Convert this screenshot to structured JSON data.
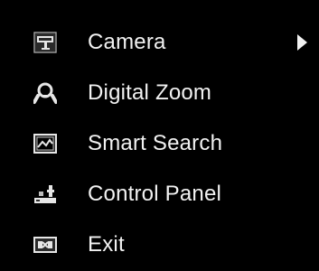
{
  "menu": {
    "items": [
      {
        "label": "Camera",
        "icon": "camera-icon",
        "has_submenu": true
      },
      {
        "label": "Digital Zoom",
        "icon": "digital-zoom-icon",
        "has_submenu": false
      },
      {
        "label": "Smart Search",
        "icon": "smart-search-icon",
        "has_submenu": false
      },
      {
        "label": "Control Panel",
        "icon": "control-panel-icon",
        "has_submenu": false
      },
      {
        "label": "Exit",
        "icon": "exit-icon",
        "has_submenu": false
      }
    ]
  },
  "colors": {
    "background": "#000000",
    "text": "#f2f2f2",
    "icon": "#d9d9d9"
  }
}
